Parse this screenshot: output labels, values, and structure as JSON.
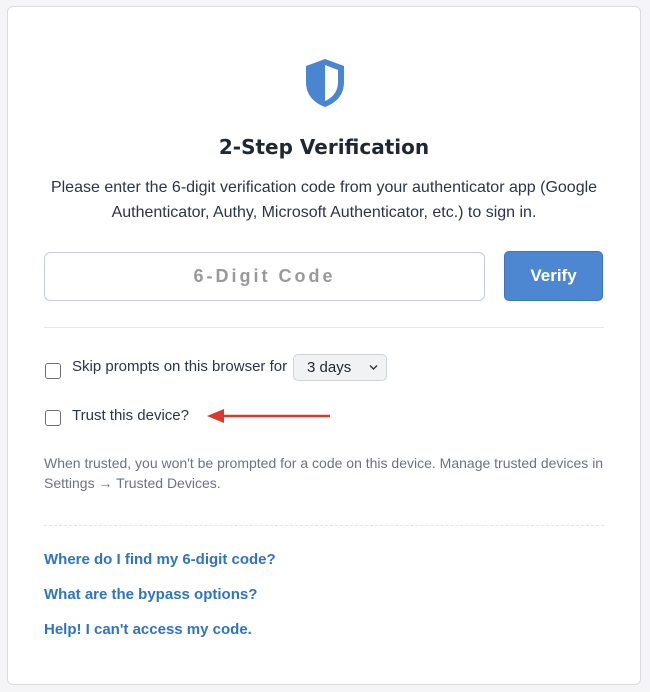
{
  "header": {
    "icon": "shield-icon",
    "title": "2-Step Verification",
    "subtitle": "Please enter the 6-digit verification code from your authenticator app (Google Authenticator, Authy, Microsoft Authenticator, etc.) to sign in."
  },
  "code_form": {
    "placeholder": "6-Digit Code",
    "value": "",
    "verify_label": "Verify"
  },
  "options": {
    "skip_prompts": {
      "label": "Skip prompts on this browser for",
      "checked": false,
      "duration_selected": "3 days"
    },
    "trust_device": {
      "label": "Trust this device?",
      "checked": false
    },
    "trust_note": "When trusted, you won't be prompted for a code on this device. Manage trusted devices in Settings → Trusted Devices."
  },
  "help_links": [
    {
      "label": "Where do I find my 6-digit code?"
    },
    {
      "label": "What are the bypass options?"
    },
    {
      "label": "Help! I can't access my code."
    }
  ],
  "colors": {
    "accent": "#4d87d1",
    "link": "#2f74c0",
    "annotation_arrow": "#d93a2b",
    "shield": "#4a86cf"
  }
}
